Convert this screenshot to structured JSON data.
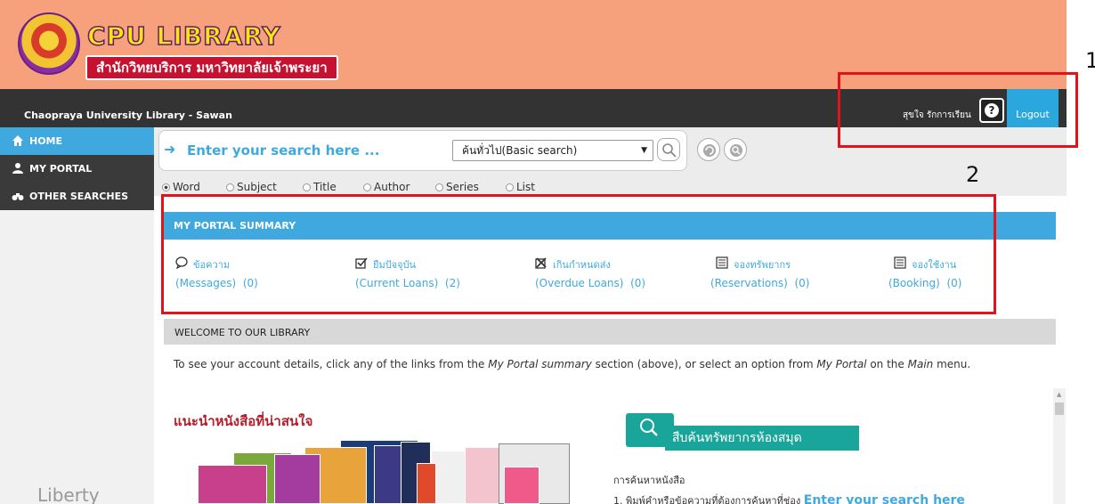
{
  "header": {
    "logo_title": "CPU LIBRARY",
    "logo_subtitle": "สำนักวิทยบริการ มหาวิทยาลัยเจ้าพระยา"
  },
  "topbar": {
    "site_name": "Chaopraya University Library - Sawan",
    "user_name": "สุขใจ รักการเรียน",
    "help_label": "?",
    "logout_label": "Logout"
  },
  "sidebar": {
    "items": [
      {
        "label": "HOME",
        "icon": "home-icon",
        "active": true
      },
      {
        "label": "MY PORTAL",
        "icon": "user-icon",
        "active": false
      },
      {
        "label": "OTHER SEARCHES",
        "icon": "binoculars-icon",
        "active": false
      }
    ],
    "footer_text": "Liberty"
  },
  "search": {
    "placeholder": "Enter your search here ...",
    "type_selected": "ค้นทั่วไป(Basic search)",
    "options": [
      {
        "label": "Word",
        "selected": true
      },
      {
        "label": "Subject",
        "selected": false
      },
      {
        "label": "Title",
        "selected": false
      },
      {
        "label": "Author",
        "selected": false
      },
      {
        "label": "Series",
        "selected": false
      },
      {
        "label": "List",
        "selected": false
      }
    ]
  },
  "portal_summary": {
    "title": "MY PORTAL SUMMARY",
    "items": [
      {
        "thai": "ข้อความ",
        "label": "(Messages)",
        "count": "(0)",
        "icon": "speech-bubble-icon"
      },
      {
        "thai": "ยืมปัจจุบัน",
        "label": "(Current Loans)",
        "count": "(2)",
        "icon": "checkbox-icon"
      },
      {
        "thai": "เกินกำหนดส่ง",
        "label": "(Overdue Loans)",
        "count": "(0)",
        "icon": "overdue-icon"
      },
      {
        "thai": "จองทรัพยากร",
        "label": "(Reservations)",
        "count": "(0)",
        "icon": "list-icon"
      },
      {
        "thai": "จองใช้งาน",
        "label": "(Booking)",
        "count": "(0)",
        "icon": "calendar-icon"
      }
    ]
  },
  "welcome": {
    "title": "WELCOME TO OUR LIBRARY",
    "text_1": "To see your account details, click any of the links from the ",
    "text_em1": "My Portal summary",
    "text_2": " section (above), or select an option from ",
    "text_em2": "My Portal",
    "text_3": " on the ",
    "text_em3": "Main",
    "text_4": " menu."
  },
  "content": {
    "recommended_title": "แนะนำหนังสือที่น่าสนใจ",
    "search_banner": "สืบค้นทรัพยากรห้องสมุด",
    "howto_title": "การค้นหาหนังสือ",
    "howto_step": "1. พิมพ์คำหรือข้อความที่ต้องการค้นหาที่ช่อง",
    "howto_step_highlight": "Enter your search here"
  },
  "annotations": {
    "label_1": "1",
    "label_2": "2"
  },
  "colors": {
    "header_bg": "#f7a07c",
    "accent_blue": "#3fa9df",
    "dark_bar": "#333333",
    "annotation_red": "#e3121b"
  }
}
